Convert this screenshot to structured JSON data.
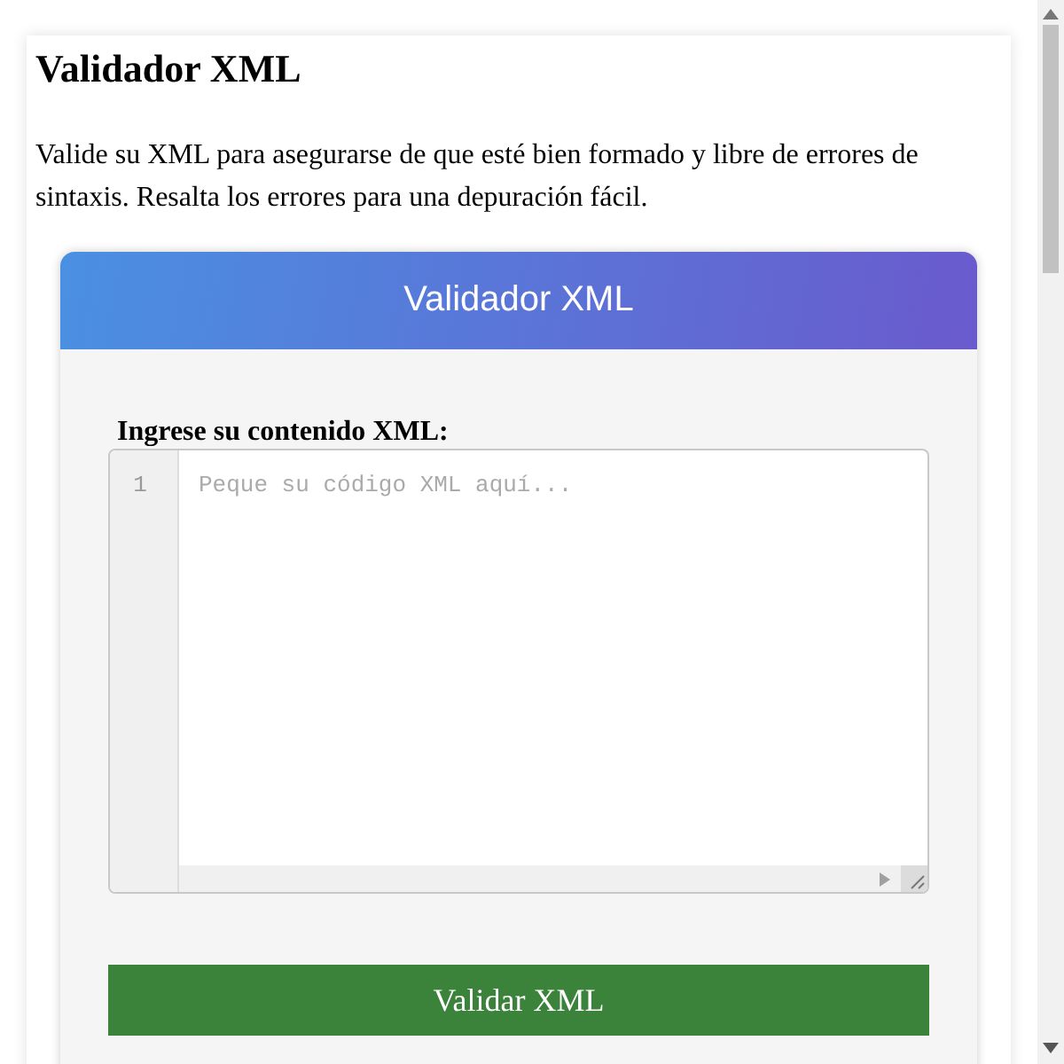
{
  "page": {
    "title": "Validador XML",
    "description": "Valide su XML para asegurarse de que esté bien formado y libre de errores de sintaxis. Resalta los errores para una depuración fácil."
  },
  "tool": {
    "header": "Validador XML",
    "label": "Ingrese su contenido XML:",
    "editor": {
      "line_numbers": [
        "1"
      ],
      "placeholder": "Peque su código XML aquí..."
    },
    "button": "Validar XML"
  }
}
